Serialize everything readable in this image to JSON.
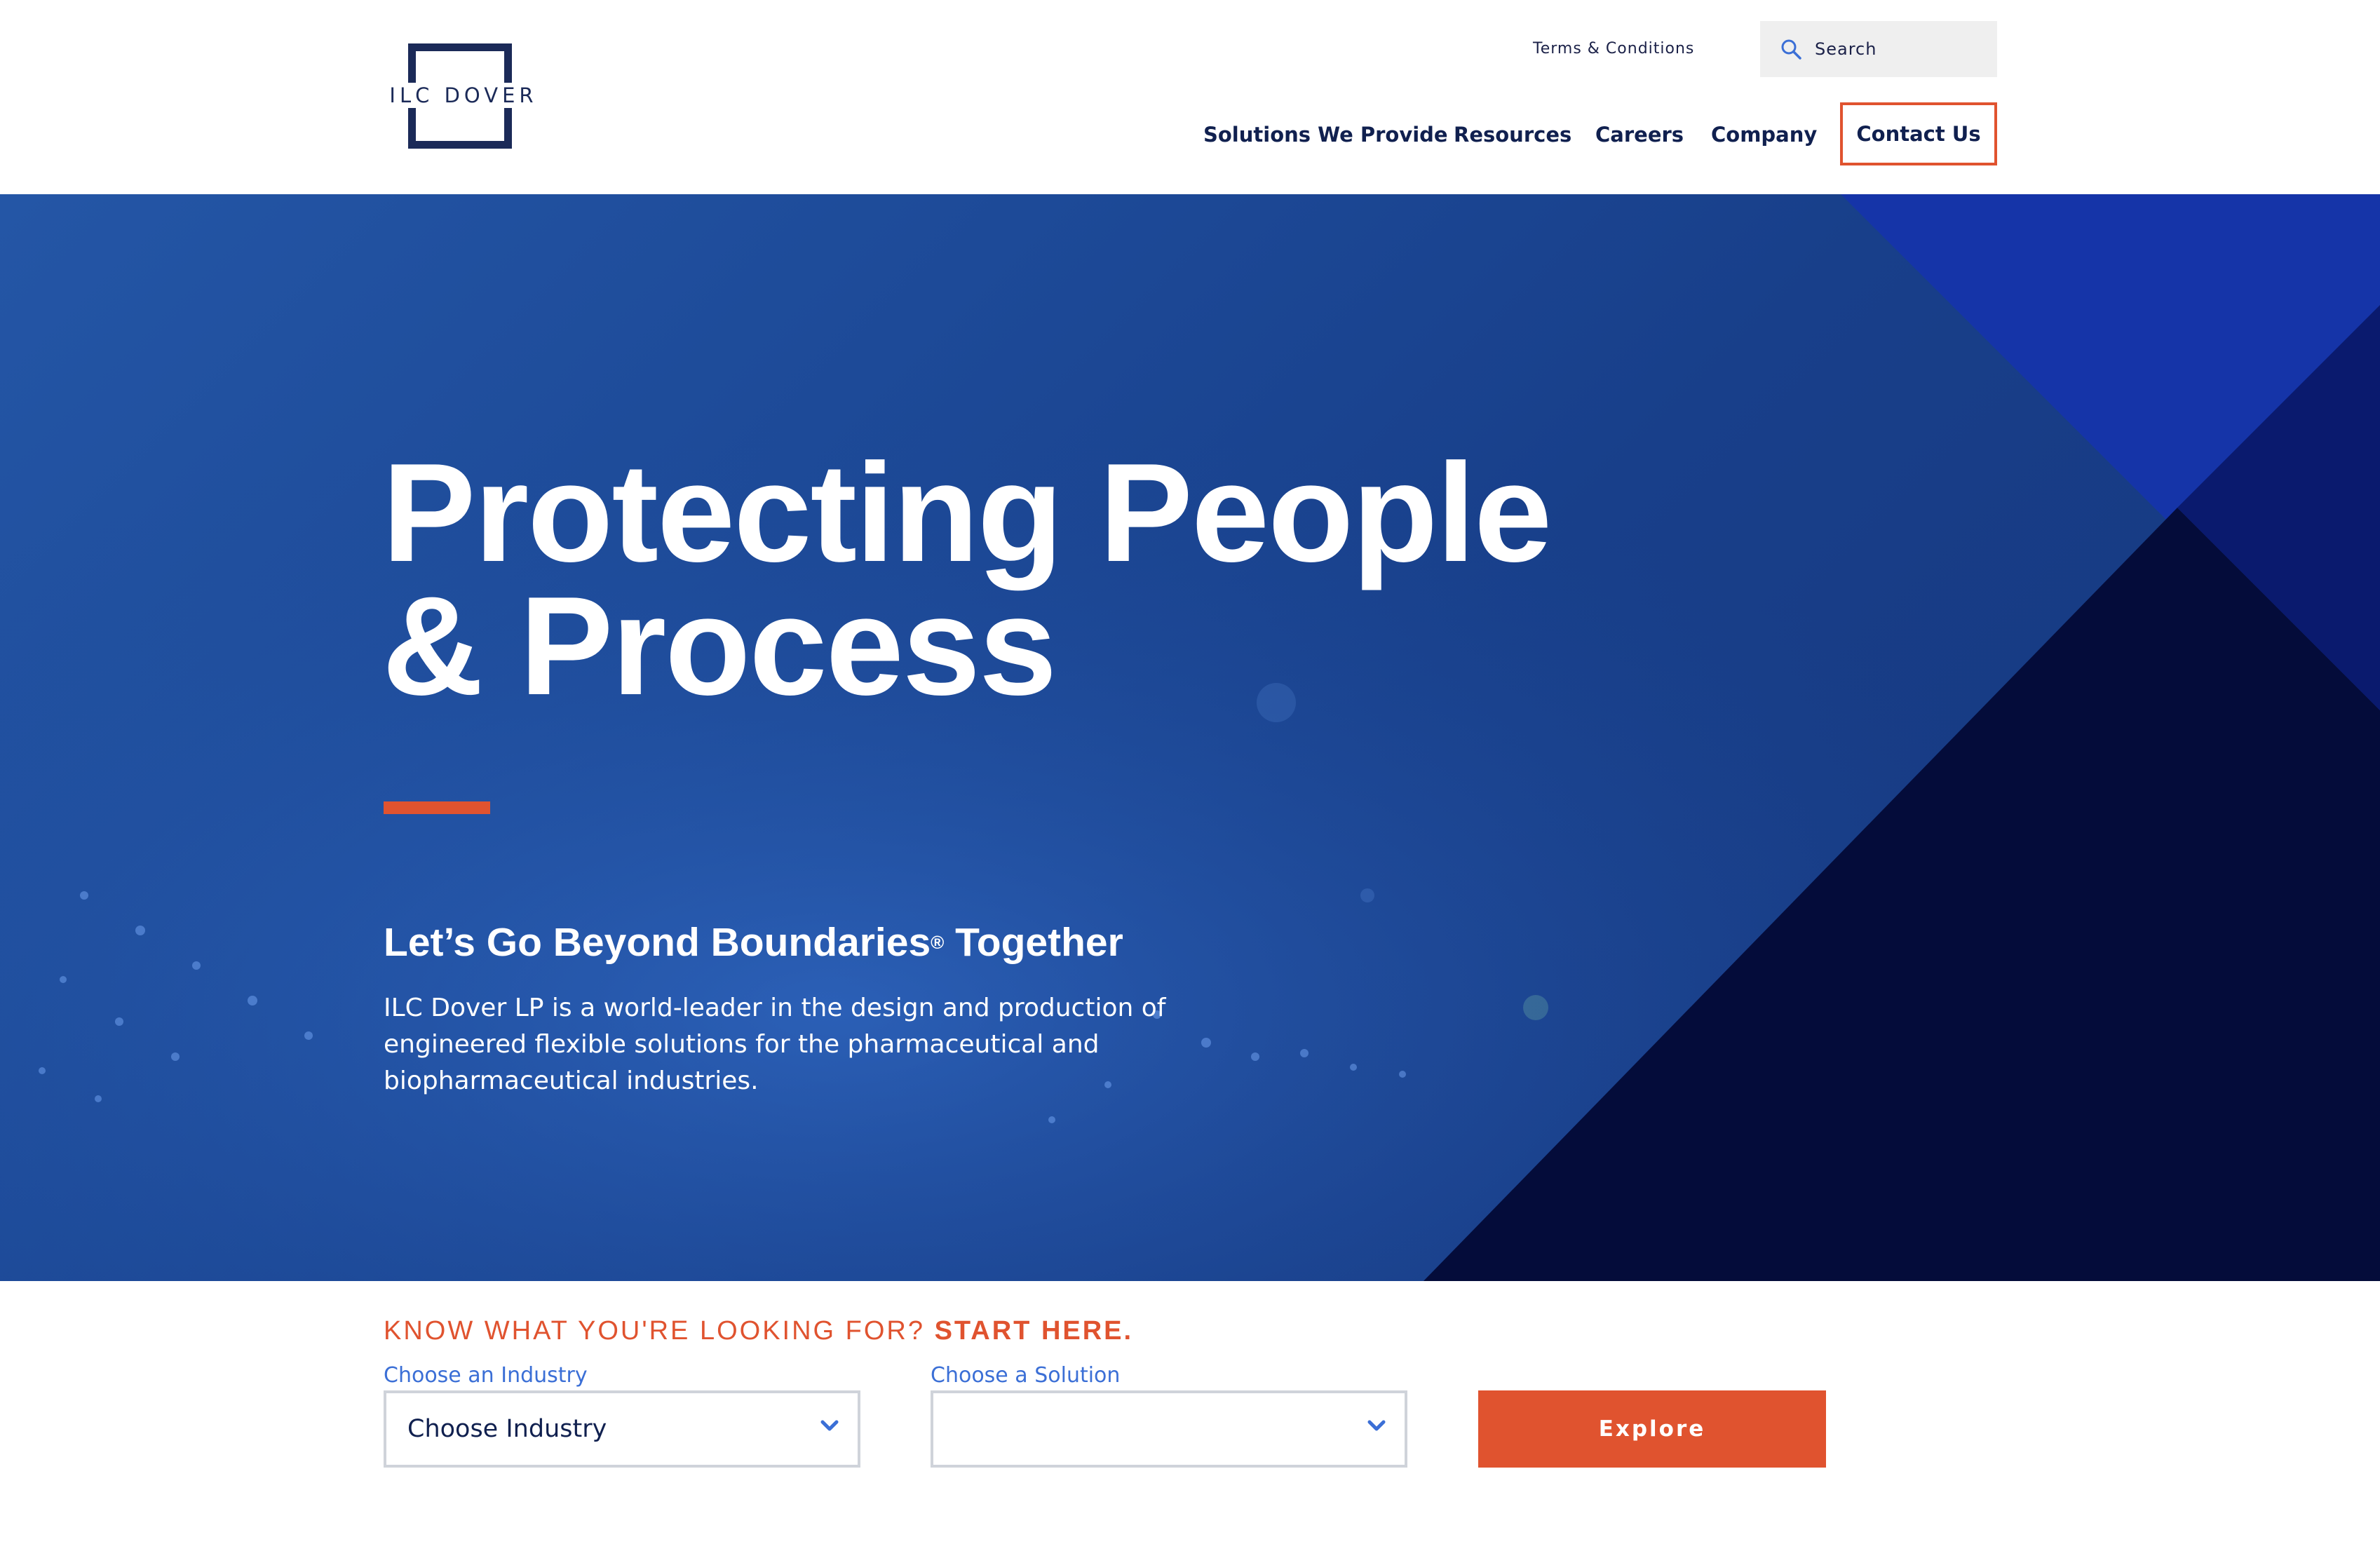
{
  "header": {
    "logo_text": "ILC DOVER",
    "terms_link": "Terms & Conditions",
    "search": {
      "placeholder": "Search",
      "icon": "search-icon"
    },
    "nav": [
      {
        "label": "Solutions We Provide"
      },
      {
        "label": "Resources"
      },
      {
        "label": "Careers"
      },
      {
        "label": "Company"
      }
    ],
    "contact_button": "Contact Us"
  },
  "hero": {
    "title_line1": "Protecting People",
    "title_line2": "& Process",
    "subtitle": "Let’s Go Beyond Boundaries",
    "subtitle_mark": "®",
    "subtitle_tail": " Together",
    "body": "ILC Dover LP is a world-leader in the design and production of engineered flexible solutions for the pharmaceutical and biopharmaceutical industries."
  },
  "finder": {
    "heading_prefix": "KNOW WHAT YOU'RE LOOKING FOR? ",
    "heading_emphasis": "START HERE.",
    "industry_label": "Choose an Industry",
    "industry_value": "Choose Industry",
    "solution_label": "Choose a Solution",
    "solution_value": "",
    "explore_button": "Explore"
  },
  "colors": {
    "navy": "#10204f",
    "accent_orange": "#e0532f",
    "link_blue": "#3b6fd6",
    "hero_blue": "#1d4a98",
    "triangle_bright": "#1534a8",
    "triangle_dark": "#040c3a"
  }
}
